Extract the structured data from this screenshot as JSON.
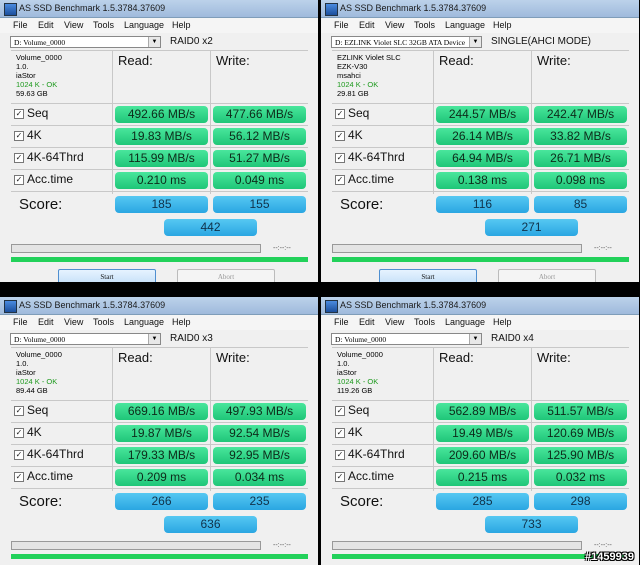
{
  "windows": [
    {
      "title": "AS SSD Benchmark 1.5.3784.37609",
      "menu": [
        "File",
        "Edit",
        "View",
        "Tools",
        "Language",
        "Help"
      ],
      "drive": "D: Volume_0000",
      "config": "RAID0 x2",
      "info": [
        "Volume_0000",
        "1.0.",
        "iaStor",
        "1024 K - OK",
        "59.63 GB"
      ],
      "headers": {
        "read": "Read:",
        "write": "Write:"
      },
      "rows": [
        {
          "label": "Seq",
          "read": "492.66 MB/s",
          "write": "477.66 MB/s"
        },
        {
          "label": "4K",
          "read": "19.83 MB/s",
          "write": "56.12 MB/s"
        },
        {
          "label": "4K-64Thrd",
          "read": "115.99 MB/s",
          "write": "51.27 MB/s"
        },
        {
          "label": "Acc.time",
          "read": "0.210 ms",
          "write": "0.049 ms"
        }
      ],
      "score_label": "Score:",
      "score": {
        "read": "185",
        "write": "155",
        "total": "442"
      },
      "progress_time": "--:--:--",
      "buttons": {
        "start": "Start",
        "abort": "Abort"
      }
    },
    {
      "title": "AS SSD Benchmark 1.5.3784.37609",
      "menu": [
        "File",
        "Edit",
        "View",
        "Tools",
        "Language",
        "Help"
      ],
      "drive": "D: EZLINK  Violet SLC 32GB ATA Device",
      "config": "SINGLE(AHCI MODE)",
      "info": [
        "EZLINK  Violet SLC",
        "EZK-V30",
        "msahci",
        "1024 K - OK",
        "29.81 GB"
      ],
      "headers": {
        "read": "Read:",
        "write": "Write:"
      },
      "rows": [
        {
          "label": "Seq",
          "read": "244.57 MB/s",
          "write": "242.47 MB/s"
        },
        {
          "label": "4K",
          "read": "26.14 MB/s",
          "write": "33.82 MB/s"
        },
        {
          "label": "4K-64Thrd",
          "read": "64.94 MB/s",
          "write": "26.71 MB/s"
        },
        {
          "label": "Acc.time",
          "read": "0.138 ms",
          "write": "0.098 ms"
        }
      ],
      "score_label": "Score:",
      "score": {
        "read": "116",
        "write": "85",
        "total": "271"
      },
      "progress_time": "--:--:--",
      "buttons": {
        "start": "Start",
        "abort": "Abort"
      }
    },
    {
      "title": "AS SSD Benchmark 1.5.3784.37609",
      "menu": [
        "File",
        "Edit",
        "View",
        "Tools",
        "Language",
        "Help"
      ],
      "drive": "D: Volume_0000",
      "config": "RAID0 x3",
      "info": [
        "Volume_0000",
        "1.0.",
        "iaStor",
        "1024 K - OK",
        "89.44 GB"
      ],
      "headers": {
        "read": "Read:",
        "write": "Write:"
      },
      "rows": [
        {
          "label": "Seq",
          "read": "669.16 MB/s",
          "write": "497.93 MB/s"
        },
        {
          "label": "4K",
          "read": "19.87 MB/s",
          "write": "92.54 MB/s"
        },
        {
          "label": "4K-64Thrd",
          "read": "179.33 MB/s",
          "write": "92.95 MB/s"
        },
        {
          "label": "Acc.time",
          "read": "0.209 ms",
          "write": "0.034 ms"
        }
      ],
      "score_label": "Score:",
      "score": {
        "read": "266",
        "write": "235",
        "total": "636"
      },
      "progress_time": "--:--:--"
    },
    {
      "title": "AS SSD Benchmark 1.5.3784.37609",
      "menu": [
        "File",
        "Edit",
        "View",
        "Tools",
        "Language",
        "Help"
      ],
      "drive": "D: Volume_0000",
      "config": "RAID0 x4",
      "info": [
        "Volume_0000",
        "1.0.",
        "iaStor",
        "1024 K - OK",
        "119.26 GB"
      ],
      "headers": {
        "read": "Read:",
        "write": "Write:"
      },
      "rows": [
        {
          "label": "Seq",
          "read": "562.89 MB/s",
          "write": "511.57 MB/s"
        },
        {
          "label": "4K",
          "read": "19.49 MB/s",
          "write": "120.69 MB/s"
        },
        {
          "label": "4K-64Thrd",
          "read": "209.60 MB/s",
          "write": "125.90 MB/s"
        },
        {
          "label": "Acc.time",
          "read": "0.215 ms",
          "write": "0.032 ms"
        }
      ],
      "score_label": "Score:",
      "score": {
        "read": "285",
        "write": "298",
        "total": "733"
      },
      "progress_time": "--:--:--"
    }
  ],
  "watermark": "#1459939",
  "colors": {
    "result_cell": "#2bd483",
    "score_cell": "#3bb6ea",
    "progress_green": "#22d15a"
  }
}
